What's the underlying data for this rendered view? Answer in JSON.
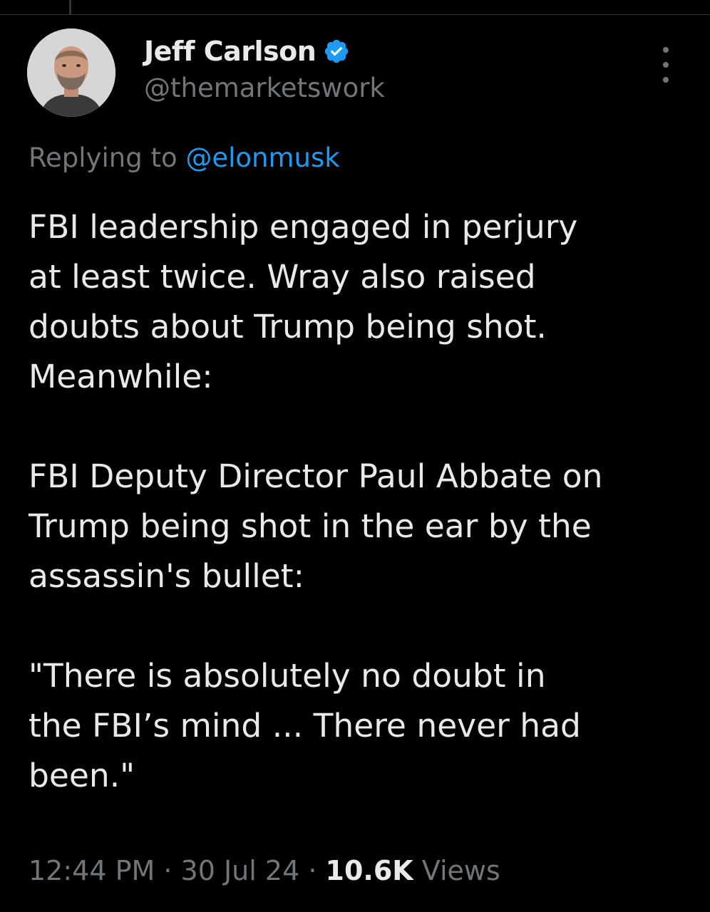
{
  "author": {
    "display_name": "Jeff Carlson",
    "handle": "@themarketswork",
    "verified": true
  },
  "reply": {
    "prefix": "Replying to ",
    "mention": "@elonmusk"
  },
  "tweet": {
    "paragraphs": [
      "FBI leadership engaged in perjury\nat least twice. Wray also raised\ndoubts about Trump being shot.\nMeanwhile:",
      "FBI Deputy Director Paul Abbate on\nTrump being shot in the ear by the\nassassin's bullet:",
      "\"There is absolutely no doubt in\nthe FBI’s mind ... There never had\nbeen.\""
    ]
  },
  "meta": {
    "time": "12:44 PM",
    "separator": " · ",
    "date": "30 Jul 24",
    "views_count": "10.6K",
    "views_label": " Views"
  },
  "colors": {
    "background": "#000000",
    "text": "#e7e9ea",
    "muted": "#71767b",
    "accent": "#1d9bf0"
  },
  "icons": {
    "verified": "verified-badge-icon",
    "more": "more-options-icon"
  }
}
